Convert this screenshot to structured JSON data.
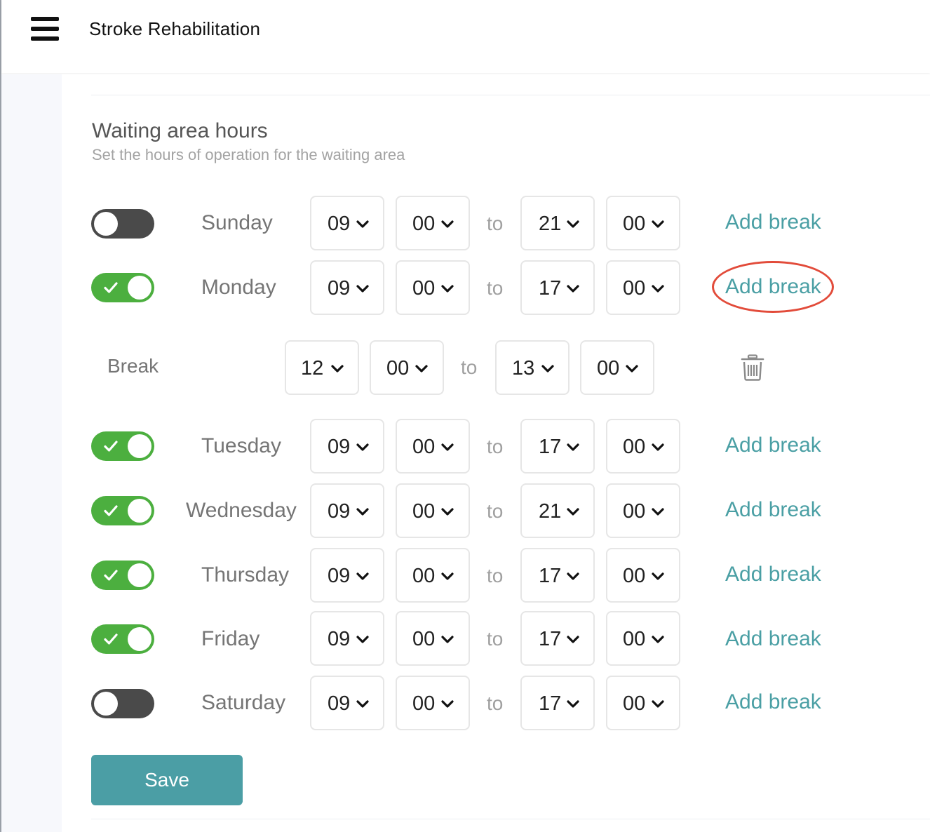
{
  "header": {
    "title": "Stroke Rehabilitation"
  },
  "section": {
    "title": "Waiting area hours",
    "subtitle": "Set the hours of operation for the waiting area"
  },
  "to_label": "to",
  "add_break_label": "Add break",
  "days": [
    {
      "name": "Sunday",
      "enabled": false,
      "from_hour": "09",
      "from_min": "00",
      "to_hour": "21",
      "to_min": "00"
    },
    {
      "name": "Monday",
      "enabled": true,
      "from_hour": "09",
      "from_min": "00",
      "to_hour": "17",
      "to_min": "00"
    },
    {
      "name": "Tuesday",
      "enabled": true,
      "from_hour": "09",
      "from_min": "00",
      "to_hour": "17",
      "to_min": "00"
    },
    {
      "name": "Wednesday",
      "enabled": true,
      "from_hour": "09",
      "from_min": "00",
      "to_hour": "21",
      "to_min": "00"
    },
    {
      "name": "Thursday",
      "enabled": true,
      "from_hour": "09",
      "from_min": "00",
      "to_hour": "17",
      "to_min": "00"
    },
    {
      "name": "Friday",
      "enabled": true,
      "from_hour": "09",
      "from_min": "00",
      "to_hour": "17",
      "to_min": "00"
    },
    {
      "name": "Saturday",
      "enabled": false,
      "from_hour": "09",
      "from_min": "00",
      "to_hour": "17",
      "to_min": "00"
    }
  ],
  "break": {
    "label": "Break",
    "from_hour": "12",
    "from_min": "00",
    "to_hour": "13",
    "to_min": "00"
  },
  "save_label": "Save",
  "colors": {
    "toggle_on": "#4caf3f",
    "toggle_off": "#4a4a4a",
    "link": "#4a9fa4",
    "save_button": "#4b9ea5",
    "annotation": "#e24b3a"
  },
  "icons": {
    "menu": "hamburger-menu-icon",
    "check": "check-icon",
    "chevron": "chevron-down-icon",
    "delete": "trash-icon"
  }
}
